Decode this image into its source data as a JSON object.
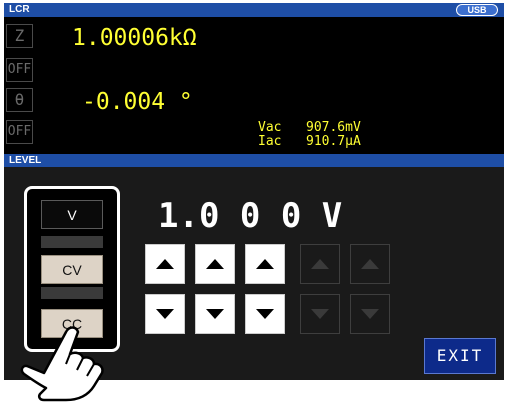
{
  "lcr_bar": {
    "title": "LCR",
    "usb_badge": "USB"
  },
  "measurement": {
    "param1": {
      "name": "Z",
      "value": "1.00006kΩ"
    },
    "param2": {
      "name": "OFF"
    },
    "param3": {
      "name": "θ",
      "value": "-0.004 °"
    },
    "param4": {
      "name": "OFF"
    },
    "monitor": {
      "vac_label": "Vac",
      "vac_value": "907.6mV",
      "iac_label": "Iac",
      "iac_value": "910.7μA"
    }
  },
  "level_bar": {
    "title": "LEVEL"
  },
  "level": {
    "display": "1.0 0 0 V",
    "modes": [
      {
        "label": "V",
        "selected": true
      },
      {
        "label": "CV",
        "selected": false
      },
      {
        "label": "CC",
        "selected": false
      }
    ],
    "exit_label": "EXIT"
  },
  "colors": {
    "title_bar": "#1e4ea6",
    "measurement_text": "#ffff33",
    "exit_button": "#0d2a8a"
  }
}
